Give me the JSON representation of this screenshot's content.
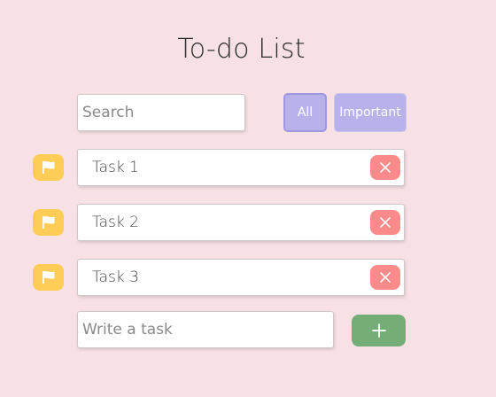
{
  "title": "To-do List",
  "search": {
    "placeholder": "Search",
    "value": ""
  },
  "filters": {
    "all_label": "All",
    "important_label": "Important",
    "selected": "All"
  },
  "tasks": [
    {
      "text": "Task 1",
      "flag_icon": "flag-icon",
      "delete_icon": "close-icon"
    },
    {
      "text": "Task 2",
      "flag_icon": "flag-icon",
      "delete_icon": "close-icon"
    },
    {
      "text": "Task 3",
      "flag_icon": "flag-icon",
      "delete_icon": "close-icon"
    }
  ],
  "new_task": {
    "placeholder": "Write a task",
    "value": ""
  },
  "add_button": {
    "icon": "plus-icon"
  },
  "colors": {
    "background": "#f7e1e5",
    "filter_button": "#b8b2ea",
    "flag": "#ffcc55",
    "delete": "#fb8a8a",
    "add": "#74ad76"
  }
}
